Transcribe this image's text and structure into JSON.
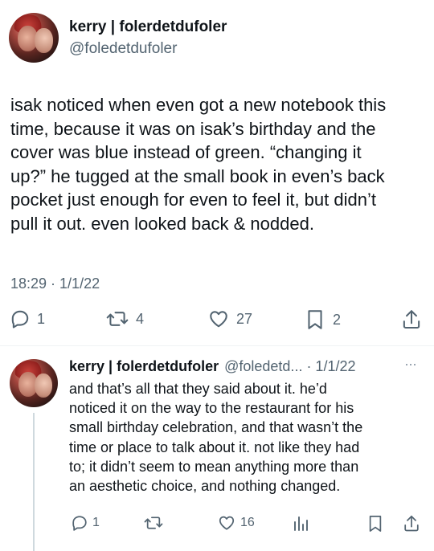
{
  "main_tweet": {
    "display_name": "kerry | folerdetdufoler",
    "handle": "@foledetdufoler",
    "text_lines": [
      "isak noticed when even got a new notebook this",
      "time, because it was on isak’s birthday and the",
      "cover was blue instead of green. “changing it",
      "up?” he tugged at the small book in even’s back",
      "pocket just enough for even to feel it, but didn’t",
      "pull it out. even looked back & nodded."
    ],
    "timestamp": "18:29 · 1/1/22",
    "counts": {
      "replies": "1",
      "retweets": "4",
      "likes": "27",
      "bookmarks": "2"
    }
  },
  "reply_tweet": {
    "display_name": "kerry | folerdetdufoler",
    "handle_date": "@foledetd... · 1/1/22",
    "more_label": "···",
    "text_lines": [
      "and that’s all that they said about it. he’d",
      "noticed it on the way to the restaurant for his",
      "small birthday celebration, and that wasn’t the",
      "time or place to talk about it. not like they had",
      "to; it didn’t seem to mean anything more than",
      "an aesthetic choice, and nothing changed."
    ],
    "counts": {
      "replies": "1",
      "likes": "16"
    }
  },
  "colors": {
    "text": "#0f1419",
    "secondary": "#536471",
    "divider": "#eff3f4"
  }
}
